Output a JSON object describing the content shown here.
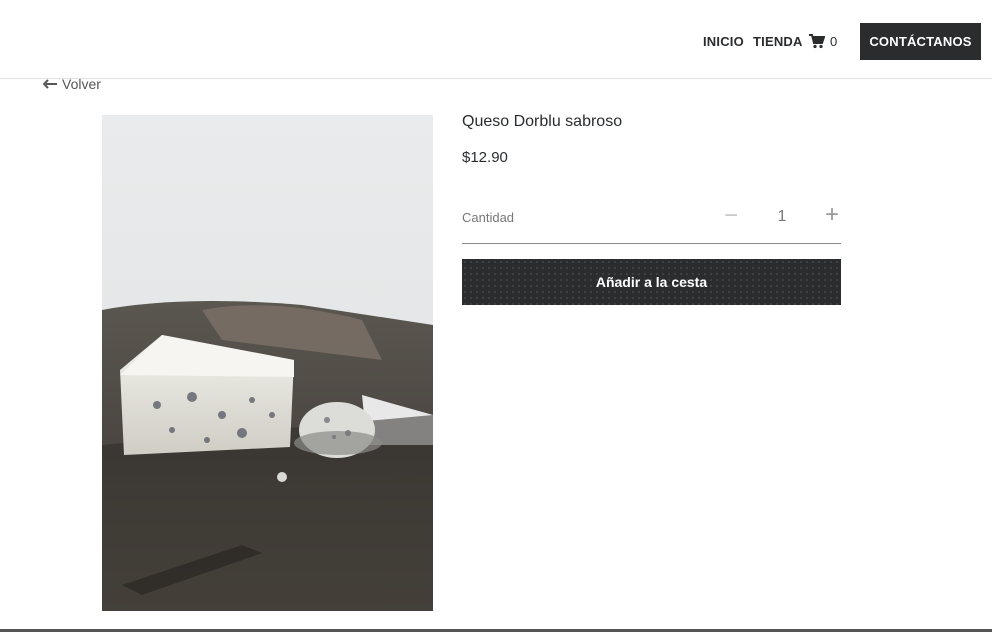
{
  "header": {
    "nav": {
      "inicio": "INICIO",
      "tienda": "TIENDA"
    },
    "cart": {
      "icon": "cart-icon",
      "count": "0"
    },
    "contact_label": "CONTÁCTANOS"
  },
  "back": {
    "icon": "arrow-left-icon",
    "label": "Volver"
  },
  "product": {
    "image_icon": "product-photo",
    "title": "Queso Dorblu sabroso",
    "price": "$12.90",
    "quantity": {
      "label": "Cantidad",
      "minus": "−",
      "value": "1",
      "plus": "+"
    },
    "add_to_cart_label": "Añadir a la cesta"
  },
  "colors": {
    "dark": "#2a2c2e",
    "muted": "#777777",
    "divider": "#e2e2e2"
  }
}
